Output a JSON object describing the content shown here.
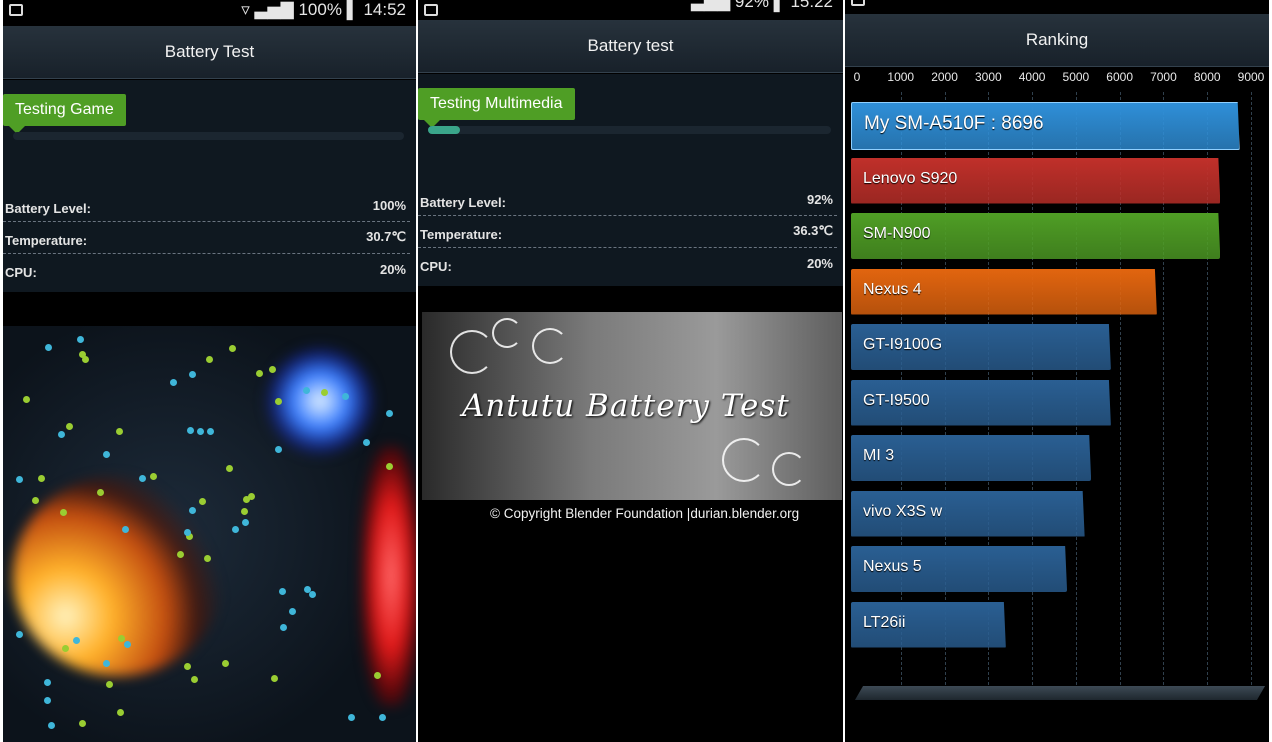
{
  "panel1": {
    "status": {
      "battery": "100%",
      "time": "14:52"
    },
    "title": "Battery Test",
    "badge": "Testing Game",
    "progress": 0,
    "stats": [
      {
        "label": "Battery Level:",
        "value": "100%"
      },
      {
        "label": "Temperature:",
        "value": "30.7℃"
      },
      {
        "label": "CPU:",
        "value": "20%"
      }
    ]
  },
  "panel2": {
    "status": {
      "battery": "92%",
      "time": "15:22"
    },
    "title": "Battery test",
    "badge": "Testing Multimedia",
    "progress": 0.08,
    "stats": [
      {
        "label": "Battery Level:",
        "value": "92%"
      },
      {
        "label": "Temperature:",
        "value": "36.3℃"
      },
      {
        "label": "CPU:",
        "value": "20%"
      }
    ],
    "banner_title": "Antutu Battery Test",
    "copyright": "© Copyright Blender Foundation |durian.blender.org"
  },
  "panel3": {
    "title": "Ranking"
  },
  "chart_data": {
    "type": "bar",
    "title": "Ranking",
    "orientation": "horizontal",
    "xlim": [
      0,
      9000
    ],
    "ticks": [
      "0",
      "1000",
      "2000",
      "3000",
      "4000",
      "5000",
      "6000",
      "7000",
      "8000",
      "9000"
    ],
    "categories": [
      "My SM-A510F",
      "Lenovo S920",
      "SM-N900",
      "Nexus 4",
      "GT-I9100G",
      "GT-I9500",
      "MI 3",
      "vivo X3S w",
      "Nexus 5",
      "LT26ii"
    ],
    "values": [
      8696,
      8300,
      8300,
      6850,
      5800,
      5800,
      5350,
      5200,
      4800,
      3400
    ],
    "value_labels": [
      "My SM-A510F :  8696",
      "Lenovo S920",
      "SM-N900",
      "Nexus 4",
      "GT-I9100G",
      "GT-I9500",
      "MI 3",
      "vivo X3S w",
      "Nexus 5",
      "LT26ii"
    ],
    "colors": [
      "#2f8fd8",
      "#c0302a",
      "#4f9e25",
      "#e2650f",
      "#2a5f93",
      "#2a5f93",
      "#2a5f93",
      "#2a5f93",
      "#2a5f93",
      "#2a5f93"
    ]
  }
}
